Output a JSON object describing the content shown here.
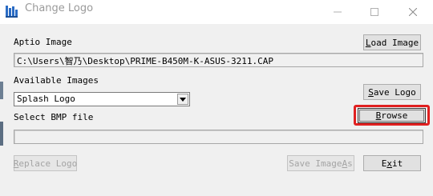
{
  "window": {
    "title": "Change Logo",
    "min_icon": "minimize-icon",
    "max_icon": "maximize-icon",
    "close_icon": "close-icon"
  },
  "aptio": {
    "label": "Aptio Image",
    "path": "C:\\Users\\智乃\\Desktop\\PRIME-B450M-K-ASUS-3211.CAP",
    "load_button": {
      "prefix": "",
      "mnemonic": "L",
      "suffix": "oad Image"
    }
  },
  "available": {
    "label": "Available Images",
    "selected": "Splash Logo",
    "save_button": {
      "prefix": "",
      "mnemonic": "S",
      "suffix": "ave Logo"
    }
  },
  "bmp": {
    "label": "Select BMP file",
    "path": "",
    "browse_button": {
      "prefix": "",
      "mnemonic": "B",
      "suffix": "rowse"
    }
  },
  "footer": {
    "replace_button": {
      "prefix": "",
      "mnemonic": "R",
      "suffix": "eplace Logo"
    },
    "saveas_button": {
      "prefix": "Save Image ",
      "mnemonic": "A",
      "suffix": "s"
    },
    "exit_button": {
      "prefix": "E",
      "mnemonic": "x",
      "suffix": "it"
    }
  },
  "colors": {
    "highlight": "#e02020",
    "title_text": "#9a9a9a"
  }
}
